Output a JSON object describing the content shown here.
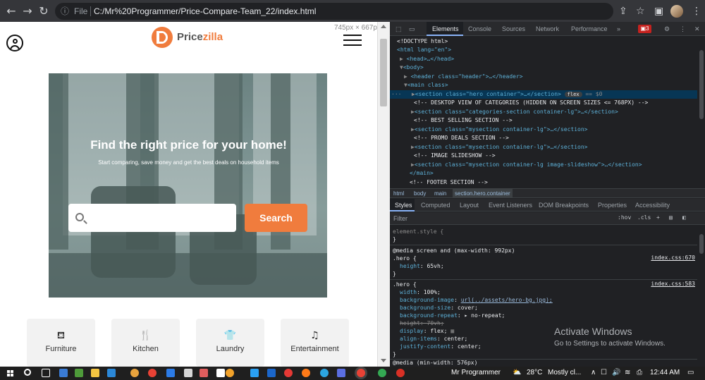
{
  "browser": {
    "url_scheme": "File",
    "url": "C:/Mr%20Programmer/Price-Compare-Team_22/index.html",
    "viewport_dims": "745px × 667px"
  },
  "site": {
    "brand_prefix": "Price",
    "brand_suffix": "zilla",
    "hero_title": "Find the right price for your home!",
    "hero_subtitle": "Start comparing, save money and get the best deals on household items",
    "search_placeholder": "",
    "search_button": "Search",
    "categories": [
      {
        "label": "Furniture",
        "icon": "sofa-icon"
      },
      {
        "label": "Kitchen",
        "icon": "fork-knife-icon"
      },
      {
        "label": "Laundry",
        "icon": "shirt-icon"
      },
      {
        "label": "Entertainment",
        "icon": "music-note-icon"
      }
    ],
    "colors": {
      "accent": "#f07c3d",
      "hero_overlay": "#7a9190"
    }
  },
  "devtools": {
    "tabs": [
      "Elements",
      "Console",
      "Sources",
      "Network",
      "Performance"
    ],
    "more_tabs": "»",
    "error_count": "3",
    "dom": [
      "<!DOCTYPE html>",
      "<html lang=\"en\">",
      "<head>…</head>",
      "<body>",
      "<header class=\"header\">…</header>",
      "<main class>",
      "<section class=\"hero container\">…</section>",
      "flex",
      "== $0",
      "<!-- DESKTOP VIEW OF CATEGORIES (HIDDEN ON SCREEN SIZES <= 768PX) -->",
      "<section class=\"categories-section container-lg\">…</section>",
      "<!--            BEST SELLING SECTION            -->",
      "<section class=\"mysection container-lg\">…</section>",
      "<!--       PROMO DEALS SECTION         -->",
      "<section class=\"mysection container-lg\">…</section>",
      "<!--                IMAGE SLIDESHOW          -->",
      "<section class=\"mysection container-lg image-slideshow\">…</section>",
      "</main>",
      "<!--            FOOTER SECTION  -->"
    ],
    "breadcrumb": [
      "html",
      "body",
      "main",
      "section.hero.container"
    ],
    "subtabs": [
      "Styles",
      "Computed",
      "Layout",
      "Event Listeners",
      "DOM Breakpoints",
      "Properties",
      "Accessibility"
    ],
    "filter_placeholder": "Filter",
    "filter_hov": ":hov",
    "filter_cls": ".cls",
    "filter_plus": "+",
    "styles": {
      "element_style": "element.style {",
      "close": "}",
      "media1": "@media screen and (max-width: 992px)",
      "sel1": ".hero {",
      "link1": "index.css:670",
      "rule1_prop": "height",
      "rule1_val": "65vh;",
      "sel2": ".hero {",
      "link2": "index.css:583",
      "props": [
        {
          "p": "width",
          "v": "100%;"
        },
        {
          "p": "background-image",
          "v": "url(../assets/hero-bg.jpg);"
        },
        {
          "p": "background-size",
          "v": "cover;"
        },
        {
          "p": "background-repeat",
          "v": "▸ no-repeat;"
        },
        {
          "p": "height",
          "v": "70vh;"
        },
        {
          "p": "display",
          "v": "flex;"
        },
        {
          "p": "align-items",
          "v": "center;"
        },
        {
          "p": "justify-content",
          "v": "center;"
        }
      ],
      "media2": "@media (min-width: 576px)"
    }
  },
  "activate_windows": {
    "title": "Activate Windows",
    "subtitle": "Go to Settings to activate Windows."
  },
  "taskbar": {
    "app_label": "Mr Programmer",
    "weather": "28°C",
    "weather_desc": "Mostly cl...",
    "time": "12:44 AM"
  }
}
